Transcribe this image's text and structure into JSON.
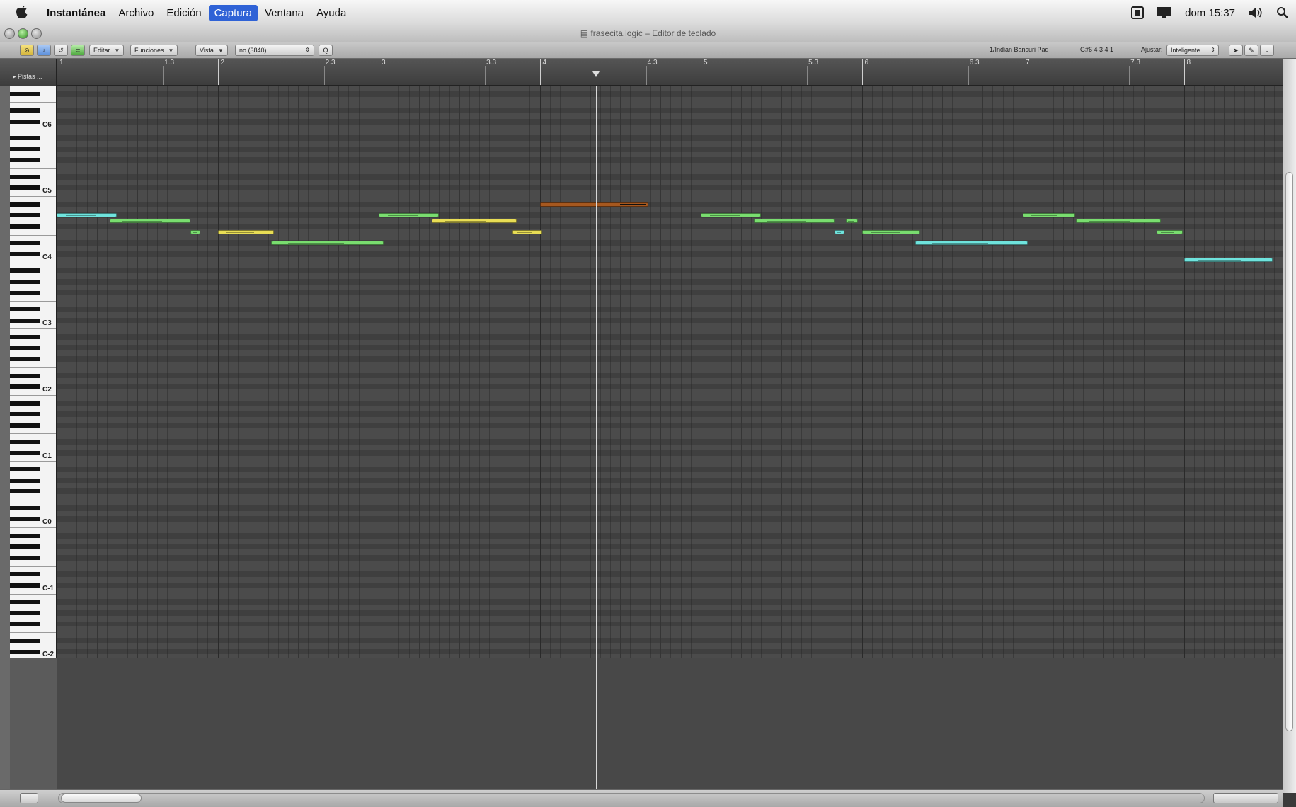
{
  "menubar": {
    "items": [
      "Instantánea",
      "Archivo",
      "Edición",
      "Captura",
      "Ventana",
      "Ayuda"
    ],
    "active": "Captura",
    "clock": "dom 15:37"
  },
  "window": {
    "title": "frasecita.logic – Editor de teclado"
  },
  "toolbar": {
    "edit_menu": "Editar",
    "functions_menu": "Funciones",
    "view_menu": "Vista",
    "quantize_value": "no (3840)",
    "quantize_button": "Q",
    "track_name": "1/Indian Bansuri Pad",
    "position_readout": "G#6  4 3 4 1",
    "snap_label": "Ajustar:",
    "snap_value": "Inteligente"
  },
  "ruler": {
    "tracks_label": "▸ Pistas ...",
    "bars": [
      "1",
      "2",
      "3",
      "4",
      "5",
      "6",
      "7",
      "8"
    ],
    "beats": [
      "1.3",
      "2.3",
      "3.3",
      "4.3",
      "5.3",
      "6.3",
      "7.3"
    ]
  },
  "keyboard": {
    "octave_labels": [
      "C6",
      "C5",
      "C4",
      "C3",
      "C2",
      "C1",
      "C0",
      "C-1",
      "C-2"
    ]
  },
  "notes": [
    {
      "start_bar": 1.0,
      "length_beats": 1.5,
      "pitch": "G#4",
      "color": "cyan"
    },
    {
      "start_bar": 1.33,
      "length_beats": 2.0,
      "pitch": "G4",
      "color": "green"
    },
    {
      "start_bar": 1.83,
      "length_beats": 0.25,
      "pitch": "F4",
      "color": "green"
    },
    {
      "start_bar": 2.0,
      "length_beats": 1.4,
      "pitch": "F4",
      "color": "yellow"
    },
    {
      "start_bar": 2.33,
      "length_beats": 2.8,
      "pitch": "D#4",
      "color": "green"
    },
    {
      "start_bar": 3.0,
      "length_beats": 1.5,
      "pitch": "G#4",
      "color": "green"
    },
    {
      "start_bar": 3.33,
      "length_beats": 2.1,
      "pitch": "G4",
      "color": "yellow"
    },
    {
      "start_bar": 3.83,
      "length_beats": 0.75,
      "pitch": "F4",
      "color": "yellow"
    },
    {
      "start_bar": 4.0,
      "length_beats": 2.7,
      "pitch": "A#4",
      "color": "orange"
    },
    {
      "start_bar": 5.0,
      "length_beats": 1.5,
      "pitch": "G#4",
      "color": "green"
    },
    {
      "start_bar": 5.33,
      "length_beats": 2.0,
      "pitch": "G4",
      "color": "green"
    },
    {
      "start_bar": 5.83,
      "length_beats": 0.25,
      "pitch": "F4",
      "color": "cyan"
    },
    {
      "start_bar": 5.9,
      "length_beats": 0.3,
      "pitch": "G4",
      "color": "green"
    },
    {
      "start_bar": 6.0,
      "length_beats": 1.45,
      "pitch": "F4",
      "color": "green"
    },
    {
      "start_bar": 6.33,
      "length_beats": 2.8,
      "pitch": "D#4",
      "color": "cyan"
    },
    {
      "start_bar": 7.0,
      "length_beats": 1.3,
      "pitch": "G#4",
      "color": "green"
    },
    {
      "start_bar": 7.33,
      "length_beats": 2.1,
      "pitch": "G4",
      "color": "green"
    },
    {
      "start_bar": 7.83,
      "length_beats": 0.65,
      "pitch": "F4",
      "color": "green"
    },
    {
      "start_bar": 8.0,
      "length_beats": 2.2,
      "pitch": "C4",
      "color": "cyan"
    }
  ],
  "playhead_bar": 4.35,
  "colors": {
    "green": "#79dd6f",
    "cyan": "#6fe3dd",
    "yellow": "#e8dd55",
    "orange": "#a6581f",
    "menu_highlight": "#2f62d6"
  }
}
